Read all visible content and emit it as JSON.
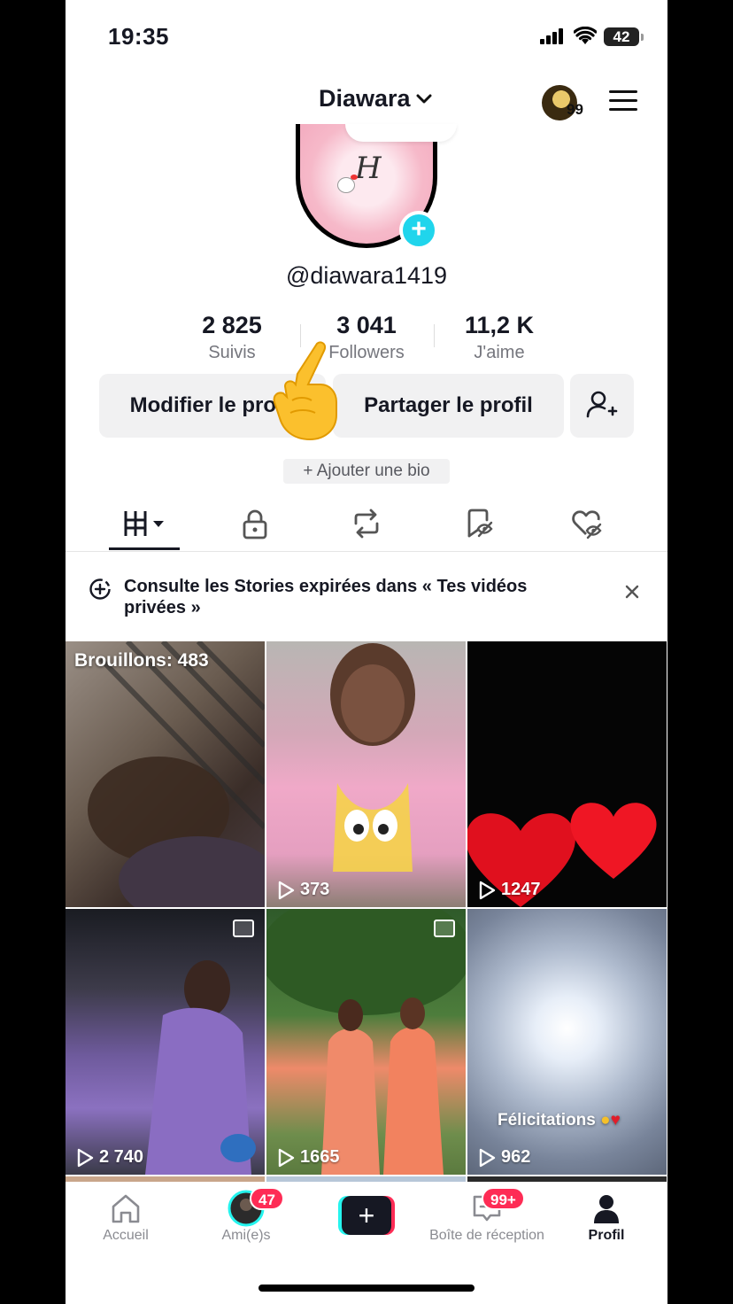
{
  "status_bar": {
    "time": "19:35",
    "battery": "42"
  },
  "header": {
    "title": "Diawara",
    "notification_count": "99"
  },
  "profile": {
    "username": "@diawara1419",
    "avatar_monogram": "H",
    "stats": [
      {
        "value": "2 825",
        "label": "Suivis"
      },
      {
        "value": "3 041",
        "label": "Followers"
      },
      {
        "value": "11,2 K",
        "label": "J'aime"
      }
    ],
    "edit_button": "Modifier le profil",
    "share_button": "Partager le profil",
    "add_bio": "+ Ajouter une bio"
  },
  "tabs": [
    "videos-grid-icon",
    "lock-icon",
    "repost-icon",
    "favorites-icon",
    "liked-icon"
  ],
  "banner": {
    "text": "Consulte les Stories expirées dans « Tes vidéos privées »"
  },
  "grid": {
    "drafts_label": "Brouillons: 483",
    "items": [
      {
        "views": "373"
      },
      {
        "views": "1247"
      },
      {
        "views": "2 740"
      },
      {
        "views": "1665"
      },
      {
        "views": "962",
        "caption": "Félicitations"
      }
    ]
  },
  "nav": {
    "home": "Accueil",
    "friends": "Ami(e)s",
    "friends_badge": "47",
    "inbox": "Boîte de réception",
    "inbox_badge": "99+",
    "profile": "Profil"
  },
  "colors": {
    "accent_red": "#fe2c55",
    "accent_cyan": "#20d5ec",
    "text": "#161823"
  }
}
